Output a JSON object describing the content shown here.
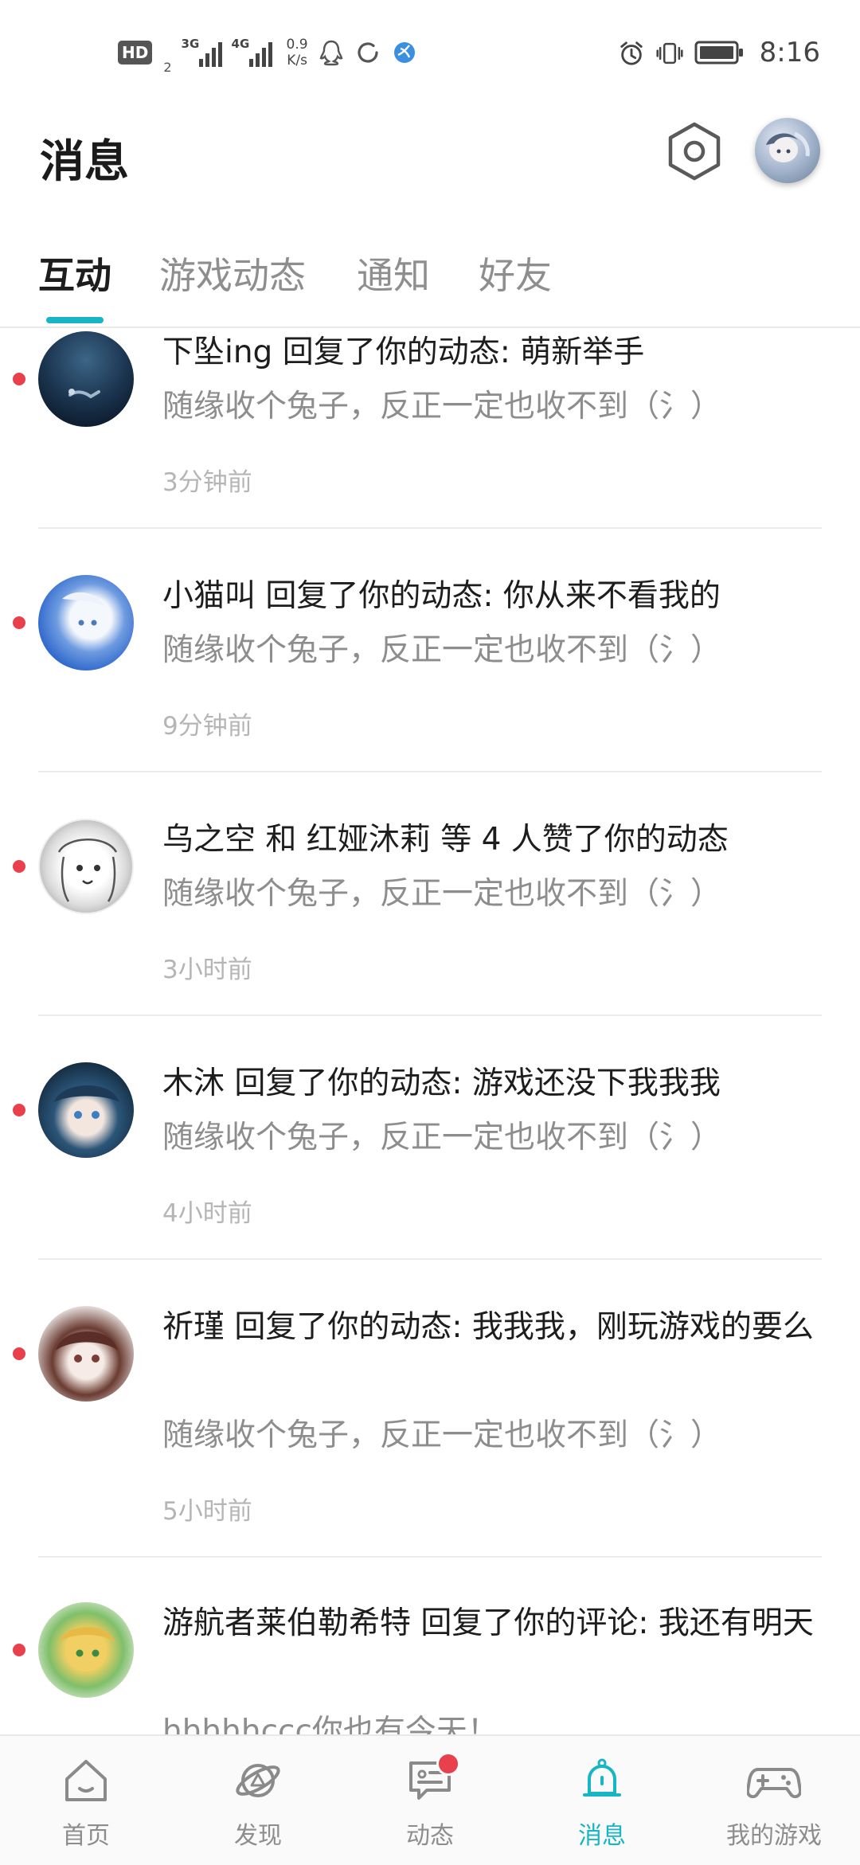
{
  "status_bar": {
    "hd_label": "HD",
    "hd_sub": "2",
    "signal_1_label": "3G",
    "signal_2_label": "4G",
    "net_speed_value": "0.9",
    "net_speed_unit": "K/s",
    "time": "8:16"
  },
  "header": {
    "title": "消息"
  },
  "tabs": [
    {
      "label": "互动",
      "active": true
    },
    {
      "label": "游戏动态",
      "active": false
    },
    {
      "label": "通知",
      "active": false
    },
    {
      "label": "好友",
      "active": false
    }
  ],
  "messages": [
    {
      "title": "下坠ing 回复了你的动态: 萌新举手",
      "preview": "随缘收个兔子，反正一定也收不到（氵）",
      "time": "3分钟前",
      "unread": true
    },
    {
      "title": "小猫叫 回复了你的动态: 你从来不看我的",
      "preview": "随缘收个兔子，反正一定也收不到（氵）",
      "time": "9分钟前",
      "unread": true
    },
    {
      "title": "乌之空 和 红娅沐莉 等 4 人赞了你的动态",
      "preview": "随缘收个兔子，反正一定也收不到（氵）",
      "time": "3小时前",
      "unread": true
    },
    {
      "title": "木沐 回复了你的动态: 游戏还没下我我我",
      "preview": "随缘收个兔子，反正一定也收不到（氵）",
      "time": "4小时前",
      "unread": true
    },
    {
      "title": "祈瑾 回复了你的动态: 我我我，刚玩游戏的要么",
      "preview": "随缘收个兔子，反正一定也收不到（氵）",
      "time": "5小时前",
      "unread": true
    },
    {
      "title": "游航者莱伯勒希特 回复了你的评论: 我还有明天",
      "preview": "hhhhhccc你也有今天！",
      "time": "",
      "unread": true
    }
  ],
  "bottom_nav": [
    {
      "label": "首页",
      "icon": "home-icon",
      "active": false
    },
    {
      "label": "发现",
      "icon": "planet-icon",
      "active": false
    },
    {
      "label": "动态",
      "icon": "chat-icon",
      "active": false,
      "badge": true
    },
    {
      "label": "消息",
      "icon": "bell-icon",
      "active": true
    },
    {
      "label": "我的游戏",
      "icon": "gamepad-icon",
      "active": false
    }
  ],
  "colors": {
    "accent": "#18b5c4",
    "unread_dot": "#e8404c",
    "text_primary": "#1d1d1d",
    "text_secondary": "#8d8d8d",
    "text_time": "#b5b5b5"
  }
}
